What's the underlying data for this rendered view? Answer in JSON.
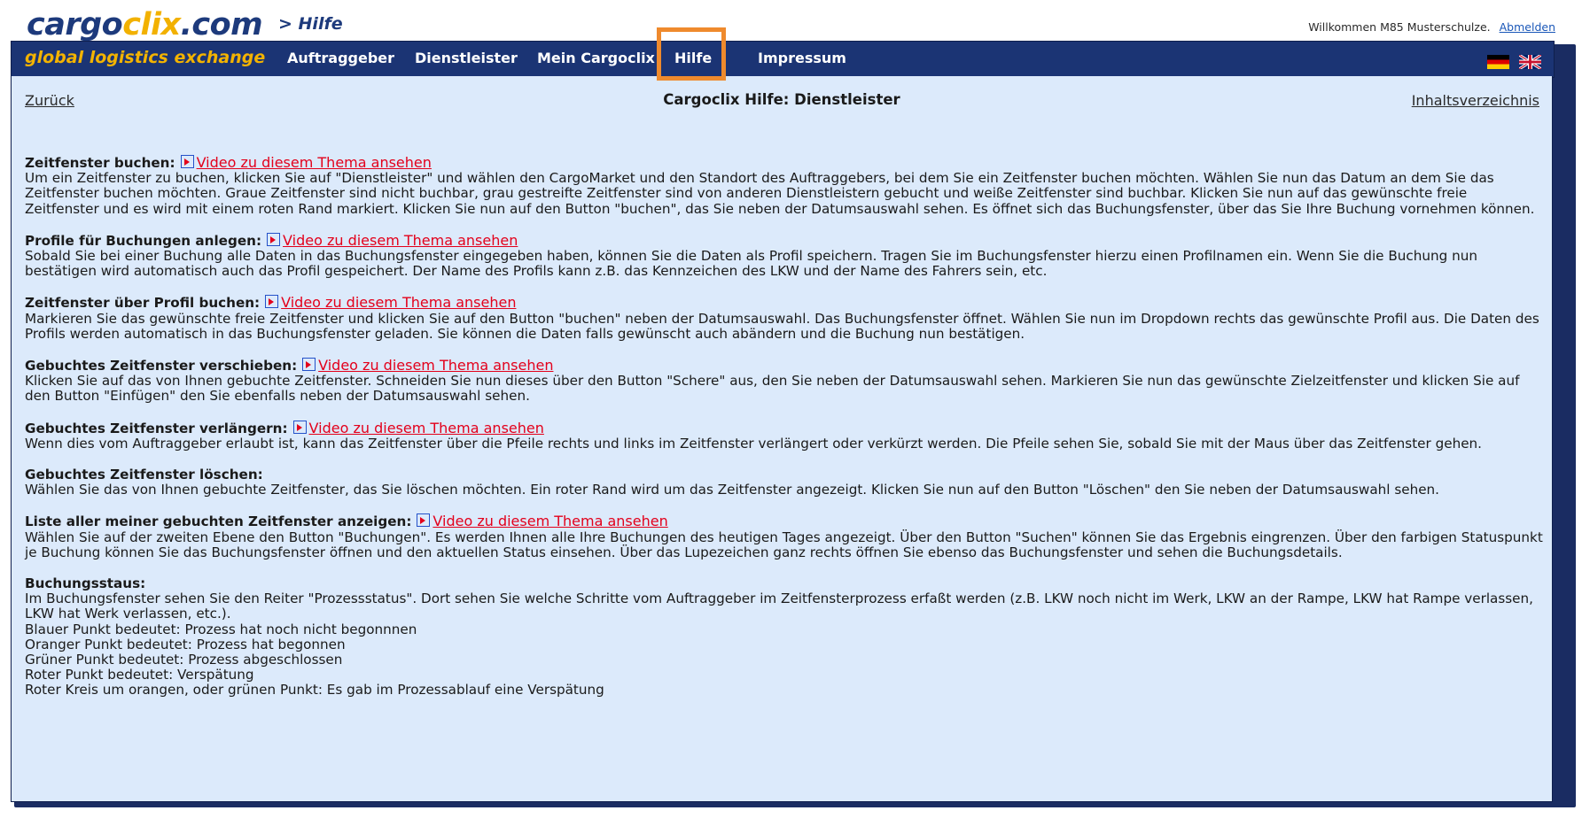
{
  "header": {
    "logo": {
      "part_a": "cargo",
      "part_b": "clix",
      "part_c": ".com"
    },
    "breadcrumb": "> Hilfe",
    "welcome_text": "Willkommen M85 Musterschulze.",
    "logout_label": "Abmelden"
  },
  "nav": {
    "tagline": "global logistics exchange",
    "items": [
      {
        "label": "Auftraggeber"
      },
      {
        "label": "Dienstleister"
      },
      {
        "label": "Mein Cargoclix"
      },
      {
        "label": "Hilfe"
      },
      {
        "label": "Impressum"
      }
    ],
    "active_item": "Hilfe",
    "highlight_color": "#ef8a2d",
    "flags": [
      "german-flag-icon",
      "uk-flag-icon"
    ]
  },
  "panel": {
    "back_label": "Zurück",
    "title": "Cargoclix Hilfe: Dienstleister",
    "toc_label": "Inhaltsverzeichnis",
    "video_link_label": "Video zu diesem Thema ansehen",
    "sections": [
      {
        "heading": "Zeitfenster buchen:",
        "has_video": true,
        "text": "Um ein Zeitfenster zu buchen, klicken Sie auf \"Dienstleister\" und wählen den CargoMarket und den Standort des Auftraggebers, bei dem Sie ein Zeitfenster buchen möchten. Wählen Sie nun das Datum an dem Sie das Zeitfenster buchen möchten. Graue Zeitfenster sind nicht buchbar, grau gestreifte Zeitfenster sind von anderen Dienstleistern gebucht und weiße Zeitfenster sind buchbar. Klicken Sie nun auf das gewünschte freie Zeitfenster und es wird mit einem roten Rand markiert. Klicken Sie nun auf den Button \"buchen\", das Sie neben der Datumsauswahl sehen. Es öffnet sich das Buchungsfenster, über das Sie Ihre Buchung vornehmen können."
      },
      {
        "heading": "Profile für Buchungen anlegen:",
        "has_video": true,
        "text": "Sobald Sie bei einer Buchung alle Daten in das Buchungsfenster eingegeben haben, können Sie die Daten als Profil speichern. Tragen Sie im Buchungsfenster hierzu einen Profilnamen ein. Wenn Sie die Buchung nun bestätigen wird automatisch auch das Profil gespeichert. Der Name des Profils kann z.B. das Kennzeichen des LKW und der Name des Fahrers sein, etc."
      },
      {
        "heading": "Zeitfenster über Profil buchen:",
        "has_video": true,
        "text": "Markieren Sie das gewünschte freie Zeitfenster und klicken Sie auf den Button \"buchen\" neben der Datumsauswahl. Das Buchungsfenster öffnet. Wählen Sie nun im Dropdown rechts das gewünschte Profil aus. Die Daten des Profils werden automatisch in das Buchungsfenster geladen. Sie können die Daten falls gewünscht auch abändern und die Buchung nun bestätigen."
      },
      {
        "heading": "Gebuchtes Zeitfenster verschieben:",
        "has_video": true,
        "text": "Klicken Sie auf das von Ihnen gebuchte Zeitfenster. Schneiden Sie nun dieses über den Button \"Schere\" aus, den Sie neben der Datumsauswahl sehen. Markieren Sie nun das gewünschte Zielzeitfenster und klicken Sie auf den Button \"Einfügen\" den Sie ebenfalls neben der Datumsauswahl sehen."
      },
      {
        "heading": "Gebuchtes Zeitfenster verlängern:",
        "has_video": true,
        "text": "Wenn dies vom Auftraggeber erlaubt ist, kann das Zeitfenster über die Pfeile rechts und links im Zeitfenster verlängert oder verkürzt werden. Die Pfeile sehen Sie, sobald Sie mit der Maus über das Zeitfenster gehen."
      },
      {
        "heading": "Gebuchtes Zeitfenster löschen:",
        "has_video": false,
        "text": "Wählen Sie das von Ihnen gebuchte Zeitfenster, das Sie löschen möchten. Ein roter Rand wird um das Zeitfenster angezeigt. Klicken Sie nun auf den Button \"Löschen\" den Sie neben der Datumsauswahl sehen."
      },
      {
        "heading": "Liste aller meiner gebuchten Zeitfenster anzeigen:",
        "has_video": true,
        "text": "Wählen Sie auf der zweiten Ebene den Button \"Buchungen\". Es werden Ihnen alle Ihre Buchungen des heutigen Tages angezeigt. Über den Button \"Suchen\" können Sie das Ergebnis eingrenzen. Über den farbigen Statuspunkt je Buchung können Sie das Buchungsfenster öffnen und den aktuellen Status einsehen. Über das Lupezeichen ganz rechts öffnen Sie ebenso das Buchungsfenster und sehen die Buchungsdetails."
      }
    ],
    "status_section": {
      "heading": "Buchungsstaus:",
      "intro": "Im Buchungsfenster sehen Sie den Reiter \"Prozessstatus\". Dort sehen Sie welche Schritte vom Auftraggeber im Zeitfensterprozess erfaßt werden (z.B. LKW noch nicht im Werk, LKW an der Rampe, LKW hat Rampe verlassen, LKW hat Werk verlassen, etc.).",
      "lines": [
        "Blauer Punkt bedeutet: Prozess hat noch nicht begonnnen",
        "Oranger Punkt bedeutet: Prozess hat begonnen",
        "Grüner Punkt bedeutet: Prozess abgeschlossen",
        "Roter Punkt bedeutet: Verspätung",
        "Roter Kreis um orangen, oder grünen Punkt: Es gab im Prozessablauf eine Verspätung"
      ]
    }
  }
}
